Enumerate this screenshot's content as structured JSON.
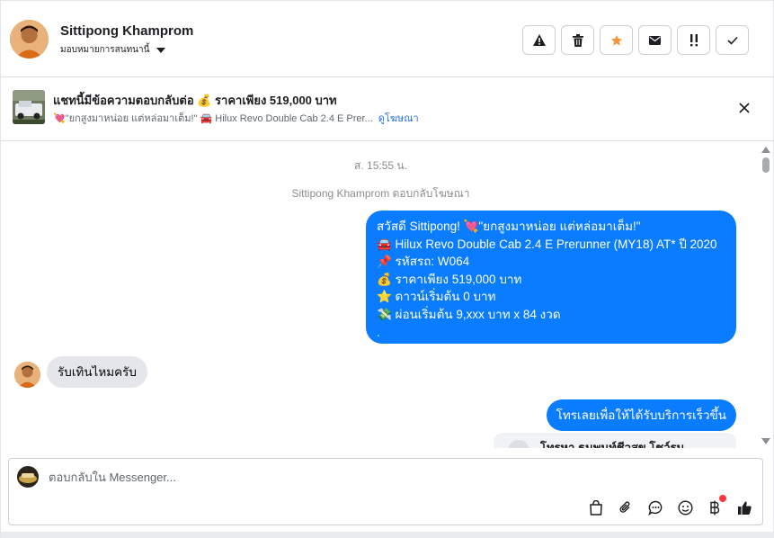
{
  "header": {
    "name": "Sittipong Khamprom",
    "assign_label": "มอบหมายการสนทนานี้",
    "actions": [
      {
        "icon": "warning-icon",
        "label": "spam"
      },
      {
        "icon": "trash-icon",
        "label": "delete"
      },
      {
        "icon": "star-icon",
        "label": "star"
      },
      {
        "icon": "mail-icon",
        "label": "mark-unread"
      },
      {
        "icon": "follow-up-icon",
        "label": "follow-up"
      },
      {
        "icon": "check-icon",
        "label": "done"
      }
    ],
    "star_color": "#f7923b"
  },
  "ad": {
    "title": "แชทนี้มีข้อความตอบกลับต่อ 💰 ราคาเพียง 519,000 บาท",
    "subtitle": "💘\"ยกสูงมาหน่อย แต่หล่อมาเต็ม!\" 🚘 Hilux Revo Double Cab 2.4 E Prer...",
    "link": "ดูโฆษณา"
  },
  "chat": {
    "timestamp": "ส. 15:55 น.",
    "replied_note": "Sittipong Khamprom ตอบกลับโฆษณา",
    "outgoing_message": [
      "สวัสดี Sittipong! 💘\"ยกสูงมาหน่อย แต่หล่อมาเต็ม!\"",
      "🚘 Hilux Revo Double Cab 2.4 E Prerunner (MY18) AT* ปี 2020",
      "📌 รหัสรถ: W064",
      "💰 ราคาเพียง 519,000 บาท",
      "⭐ ดาวน์เริ่มต้น 0 บาท",
      "💸 ผ่อนเริ่มต้น 9,xxx บาท x 84 งวด",
      "."
    ],
    "incoming_message": "รับเทินไหมครับ",
    "outgoing_message_2": "โทรเลยเพื่อให้ได้รับบริการเร็วขึ้น",
    "card_peek": "โทรหา ธนพนท์ชีวสุข โชว์รูม",
    "bubble_color": "#0a7cff"
  },
  "composer": {
    "placeholder": "ตอบกลับใน Messenger...",
    "tools": [
      "bag-icon",
      "paperclip-icon",
      "chat-bubble-icon",
      "emoji-icon",
      "baht-icon",
      "thumbs-up-icon"
    ],
    "badge_color": "#fa383e"
  }
}
